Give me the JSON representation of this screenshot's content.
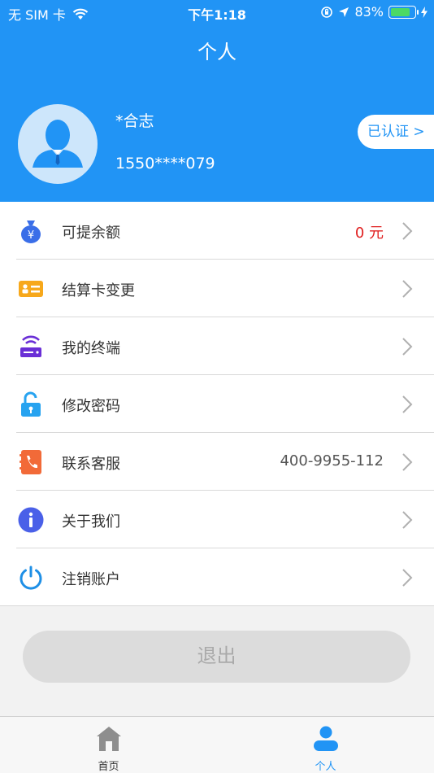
{
  "status_bar": {
    "carrier": "无 SIM 卡",
    "time": "下午1:18",
    "battery_percent": "83%",
    "battery_level": 0.83
  },
  "header": {
    "title": "个人",
    "user_name": "*合志",
    "user_phone": "1550****079",
    "verify_label": "已认证 >"
  },
  "menu": {
    "items": [
      {
        "label": "可提余额",
        "value": "0 元",
        "icon": "money-bag-icon"
      },
      {
        "label": "结算卡变更",
        "value": "",
        "icon": "id-card-icon"
      },
      {
        "label": "我的终端",
        "value": "",
        "icon": "terminal-icon"
      },
      {
        "label": "修改密码",
        "value": "",
        "icon": "unlock-icon"
      },
      {
        "label": "联系客服",
        "value": "400-9955-112",
        "icon": "phone-book-icon"
      },
      {
        "label": "关于我们",
        "value": "",
        "icon": "info-icon"
      },
      {
        "label": "注销账户",
        "value": "",
        "icon": "power-icon"
      }
    ]
  },
  "logout": {
    "label": "退出"
  },
  "tabbar": {
    "tabs": [
      {
        "label": "首页",
        "icon": "home-icon",
        "active": false
      },
      {
        "label": "个人",
        "icon": "person-icon",
        "active": true
      }
    ]
  },
  "colors": {
    "primary": "#2194f5",
    "danger": "#e02020",
    "tab_inactive": "#8e8e8e"
  }
}
